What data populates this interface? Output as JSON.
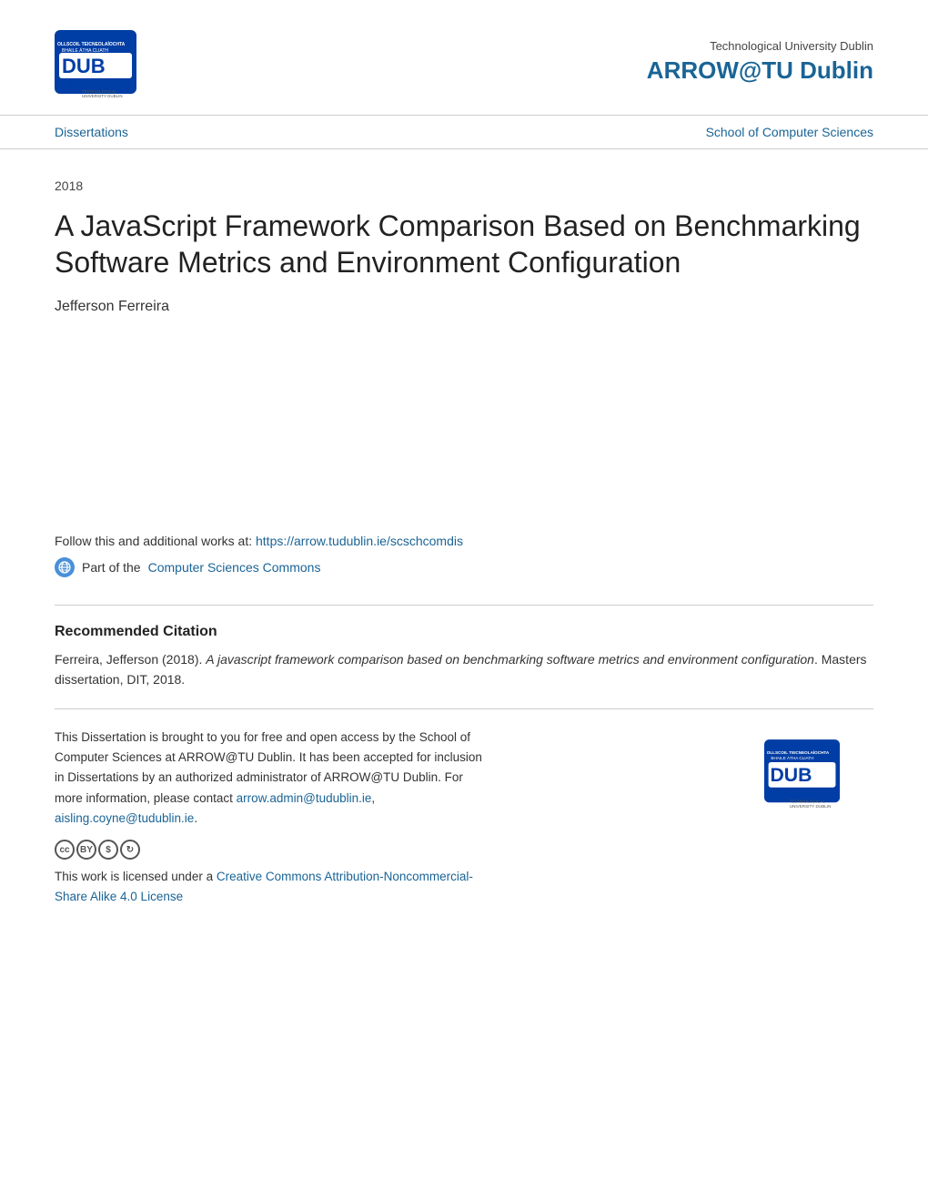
{
  "header": {
    "institution": "Technological University Dublin",
    "repo_name": "ARROW@TU Dublin",
    "logo_alt": "TU Dublin Logo"
  },
  "navbar": {
    "left_link": "Dissertations",
    "right_link": "School of Computer Sciences"
  },
  "main": {
    "year": "2018",
    "title": "A JavaScript Framework Comparison Based on Benchmarking Software Metrics and Environment Configuration",
    "author": "Jefferson Ferreira",
    "follow_text": "Follow this and additional works at: ",
    "follow_url": "https://arrow.tudublin.ie/scschcomdis",
    "part_of_prefix": "Part of the ",
    "part_of_link": "Computer Sciences Commons",
    "recommended_citation_heading": "Recommended Citation",
    "citation_text": "Ferreira, Jefferson (2018). ",
    "citation_italic": "A javascript framework comparison based on benchmarking software metrics and environment configuration",
    "citation_suffix": ". Masters dissertation, DIT, 2018.",
    "body_text": "This Dissertation is brought to you for free and open access by the School of Computer Sciences at ARROW@TU Dublin. It has been accepted for inclusion in Dissertations by an authorized administrator of ARROW@TU Dublin. For more information, please contact ",
    "contact_email1": "arrow.admin@tudublin.ie",
    "contact_comma": ",",
    "contact_email2": "aisling.coyne@tudublin.ie",
    "contact_period": ".",
    "license_prefix": "This work is licensed under a ",
    "license_link": "Creative Commons Attribution-Noncommercial-Share Alike 4.0 License"
  }
}
